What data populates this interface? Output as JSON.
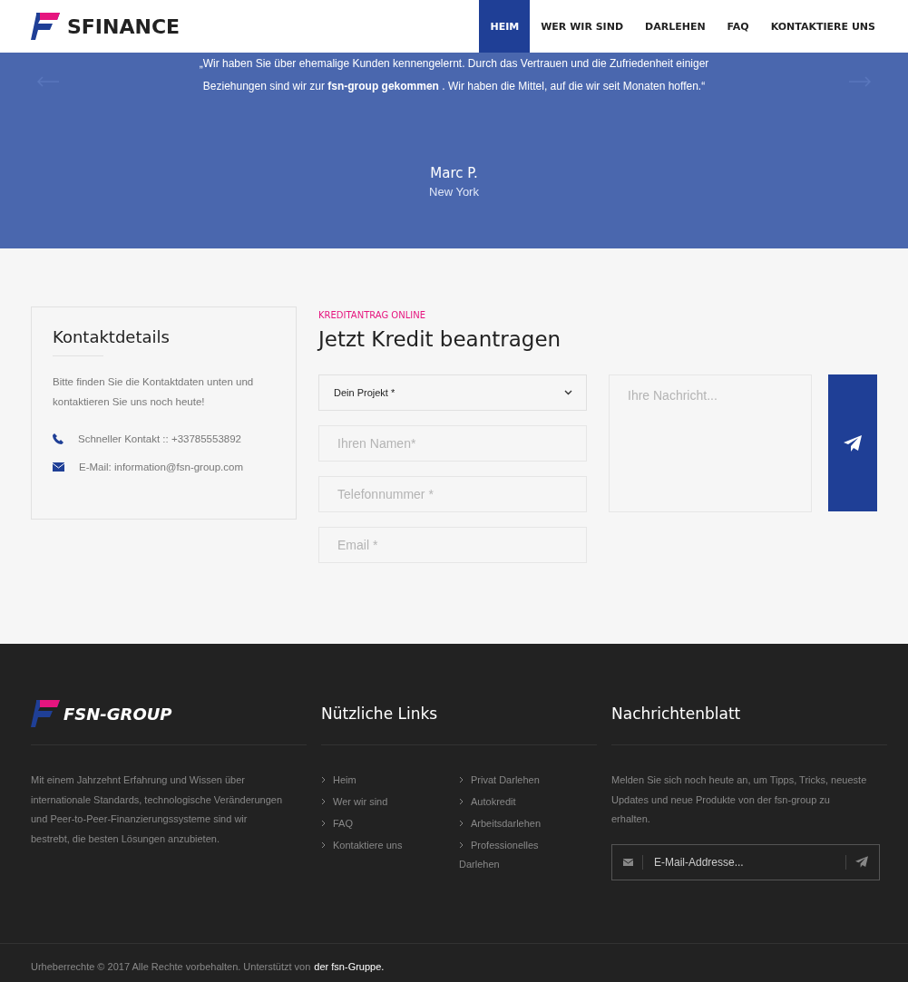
{
  "header": {
    "logo_text": "SFINANCE",
    "nav": [
      {
        "label": "HEIM",
        "selected": true
      },
      {
        "label": "WER WIR SIND",
        "selected": false
      },
      {
        "label": "DARLEHEN",
        "selected": false
      },
      {
        "label": "FAQ",
        "selected": false
      },
      {
        "label": "KONTAKTIERE UNS",
        "selected": false
      }
    ]
  },
  "testimonial": {
    "quote": "„Wir haben Sie über ehemalige Kunden kennengelernt. Durch das Vertrauen und die Zufriedenheit einiger Beziehungen sind wir zur **fsn-group gekommen** . Wir haben die Mittel, auf die wir seit Monaten hoffen.“",
    "name": "Marc P.",
    "city": "New York"
  },
  "contact": {
    "title": "Kontaktdetails",
    "text": "Bitte finden Sie die Kontaktdaten unten und kontaktieren Sie uns noch heute!",
    "items": [
      {
        "kind": "phone",
        "text": "Schneller Kontakt :: +33785553892"
      },
      {
        "kind": "mail",
        "text": "E-Mail: information@fsn-group.com"
      }
    ]
  },
  "form": {
    "kicker": "KREDITANTRAG ONLINE",
    "title": "Jetzt Kredit beantragen",
    "project_select": "Dein Projekt *",
    "fields": [
      {
        "placeholder": "Ihren Namen*"
      },
      {
        "placeholder": "Telefonnummer *"
      },
      {
        "placeholder": "Email *"
      }
    ],
    "message": {
      "placeholder": "Ihre Nachricht..."
    }
  },
  "footer": {
    "logo_text": "FSN-GROUP",
    "about": "Mit einem Jahrzehnt Erfahrung und Wissen über internationale Standards, technologische Veränderungen und Peer-to-Peer-Finanzierungssysteme sind wir bestrebt, die besten Lösungen anzubieten.",
    "links_title": "Nützliche Links",
    "links_col1": [
      "Heim",
      "Wer wir sind",
      "FAQ",
      "Kontaktiere uns"
    ],
    "links_col2": [
      "Privat Darlehen",
      "Autokredit",
      "Arbeitsdarlehen",
      "Professionelles Darlehen"
    ],
    "newsletter_title": "Nachrichtenblatt",
    "newsletter_text": "Melden Sie sich noch heute an, um Tipps, Tricks, neueste Updates und neue Produkte von der fsn-group zu erhalten.",
    "email_placeholder": "E-Mail-Addresse...",
    "copyright": "Urheberrechte © 2017 Alle Rechte vorbehalten. Unterstützt von",
    "copyright_link": "der fsn-Gruppe."
  }
}
